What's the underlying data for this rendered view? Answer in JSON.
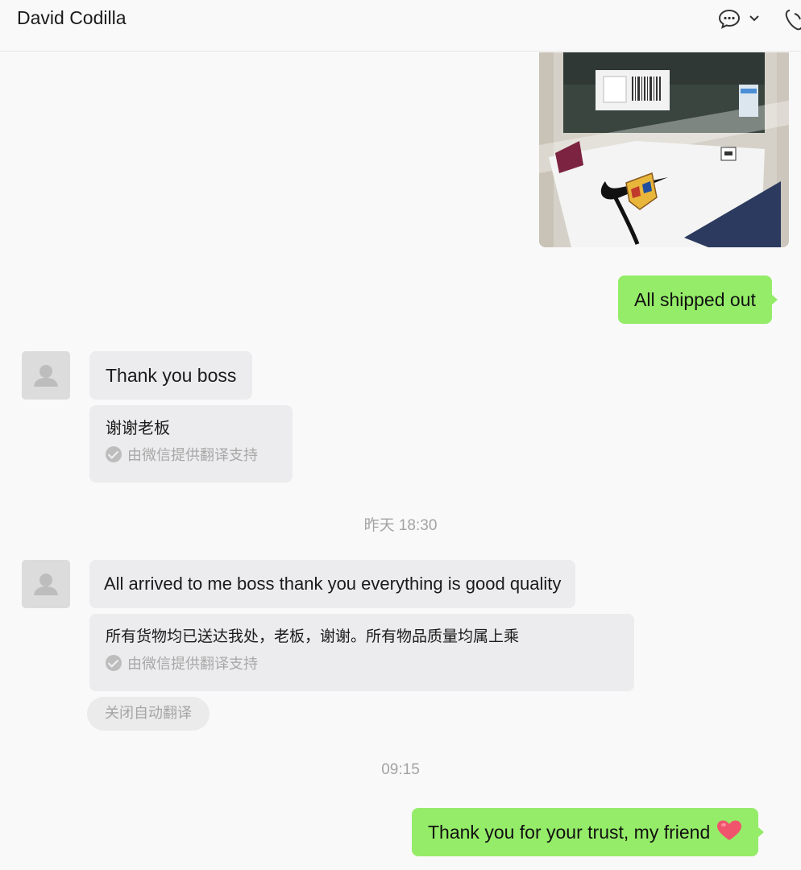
{
  "header": {
    "contact_name": "David Codilla",
    "chat_icon": "chat-bubble-icon",
    "dropdown_icon": "chevron-down-icon",
    "call_icon": "phone-icon"
  },
  "messages": [
    {
      "from": "me",
      "type": "image",
      "content": "photo of packaged shirts"
    },
    {
      "from": "me",
      "type": "text",
      "text": "All shipped out"
    },
    {
      "from": "them",
      "type": "text",
      "text": "Thank you boss",
      "translation": "谢谢老板",
      "translation_source": "由微信提供翻译支持"
    },
    {
      "type": "timestamp",
      "text": "昨天 18:30"
    },
    {
      "from": "them",
      "type": "text",
      "text": "All arrived to me boss thank you everything is good quality",
      "translation": "所有货物均已送达我处，老板，谢谢。所有物品质量均属上乘",
      "translation_source": "由微信提供翻译支持"
    },
    {
      "type": "action",
      "text": "关闭自动翻译"
    },
    {
      "type": "timestamp",
      "text": "09:15"
    },
    {
      "from": "me",
      "type": "text",
      "text": "Thank you for your trust, my friend",
      "emoji": "heart-emoji"
    }
  ],
  "colors": {
    "outgoing_bubble": "#95ec69",
    "incoming_bubble": "#ececee",
    "background": "#f9f9f9"
  }
}
